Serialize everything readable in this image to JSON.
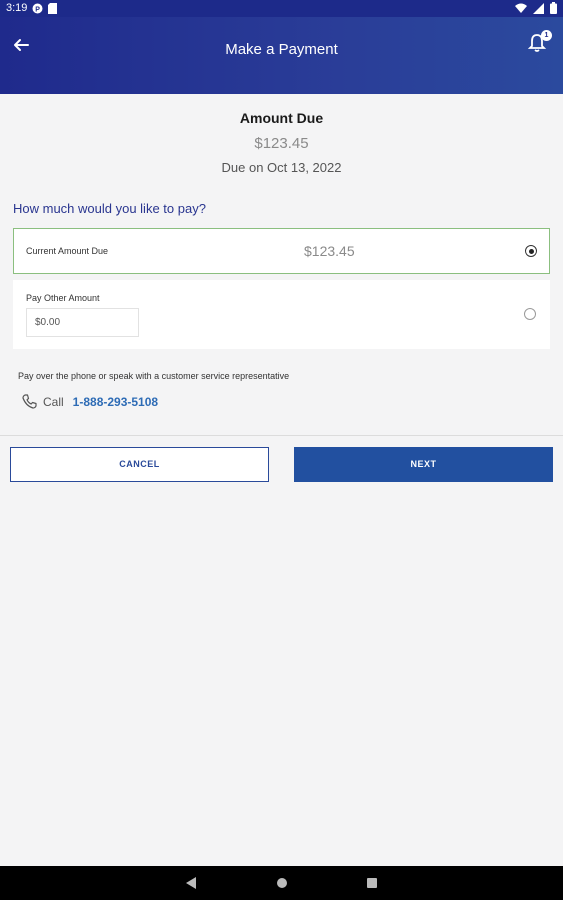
{
  "status_bar": {
    "time": "3:19"
  },
  "app_bar": {
    "title": "Make a Payment",
    "notification_count": "1"
  },
  "amount_due": {
    "title": "Amount Due",
    "value": "$123.45",
    "due_date": "Due on Oct 13, 2022"
  },
  "question": "How much would you like to pay?",
  "options": {
    "current": {
      "label": "Current Amount Due",
      "value": "$123.45",
      "selected": true
    },
    "other": {
      "label": "Pay Other Amount",
      "input_value": "$0.00",
      "selected": false
    }
  },
  "phone": {
    "note": "Pay over the phone or speak with a customer service representative",
    "call_label": "Call",
    "number": "1-888-293-5108"
  },
  "buttons": {
    "cancel": "CANCEL",
    "next": "NEXT"
  },
  "colors": {
    "app_bar": "#1f2a8c",
    "accent": "#2250a0",
    "link": "#2d6bb5",
    "selected_border": "#8bbf7f"
  }
}
